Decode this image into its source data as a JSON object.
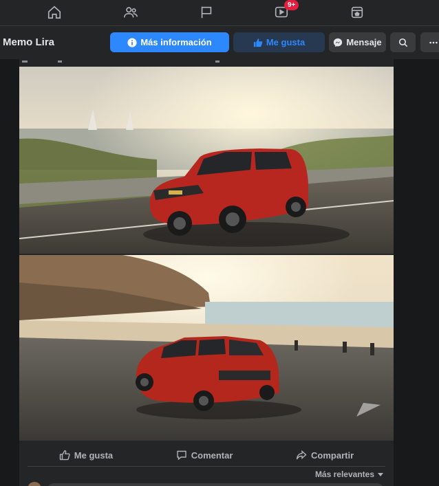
{
  "nav": {
    "items": [
      {
        "name": "home",
        "icon": "home-icon"
      },
      {
        "name": "friends",
        "icon": "friends-icon"
      },
      {
        "name": "pages",
        "icon": "flag-icon"
      },
      {
        "name": "watch",
        "icon": "video-icon",
        "badge": "9+"
      },
      {
        "name": "marketplace",
        "icon": "marketplace-icon"
      }
    ]
  },
  "page_header": {
    "name": "Memo Lira",
    "info_label": "Más información",
    "like_label": "Me gusta",
    "message_label": "Mensaje"
  },
  "post": {
    "actions": {
      "like": "Me gusta",
      "comment": "Comentar",
      "share": "Compartir"
    },
    "sort_label": "Más relevantes"
  },
  "colors": {
    "accent": "#2d88ff",
    "badge": "#e41e3f",
    "background": "#18191a",
    "surface": "#242526"
  }
}
